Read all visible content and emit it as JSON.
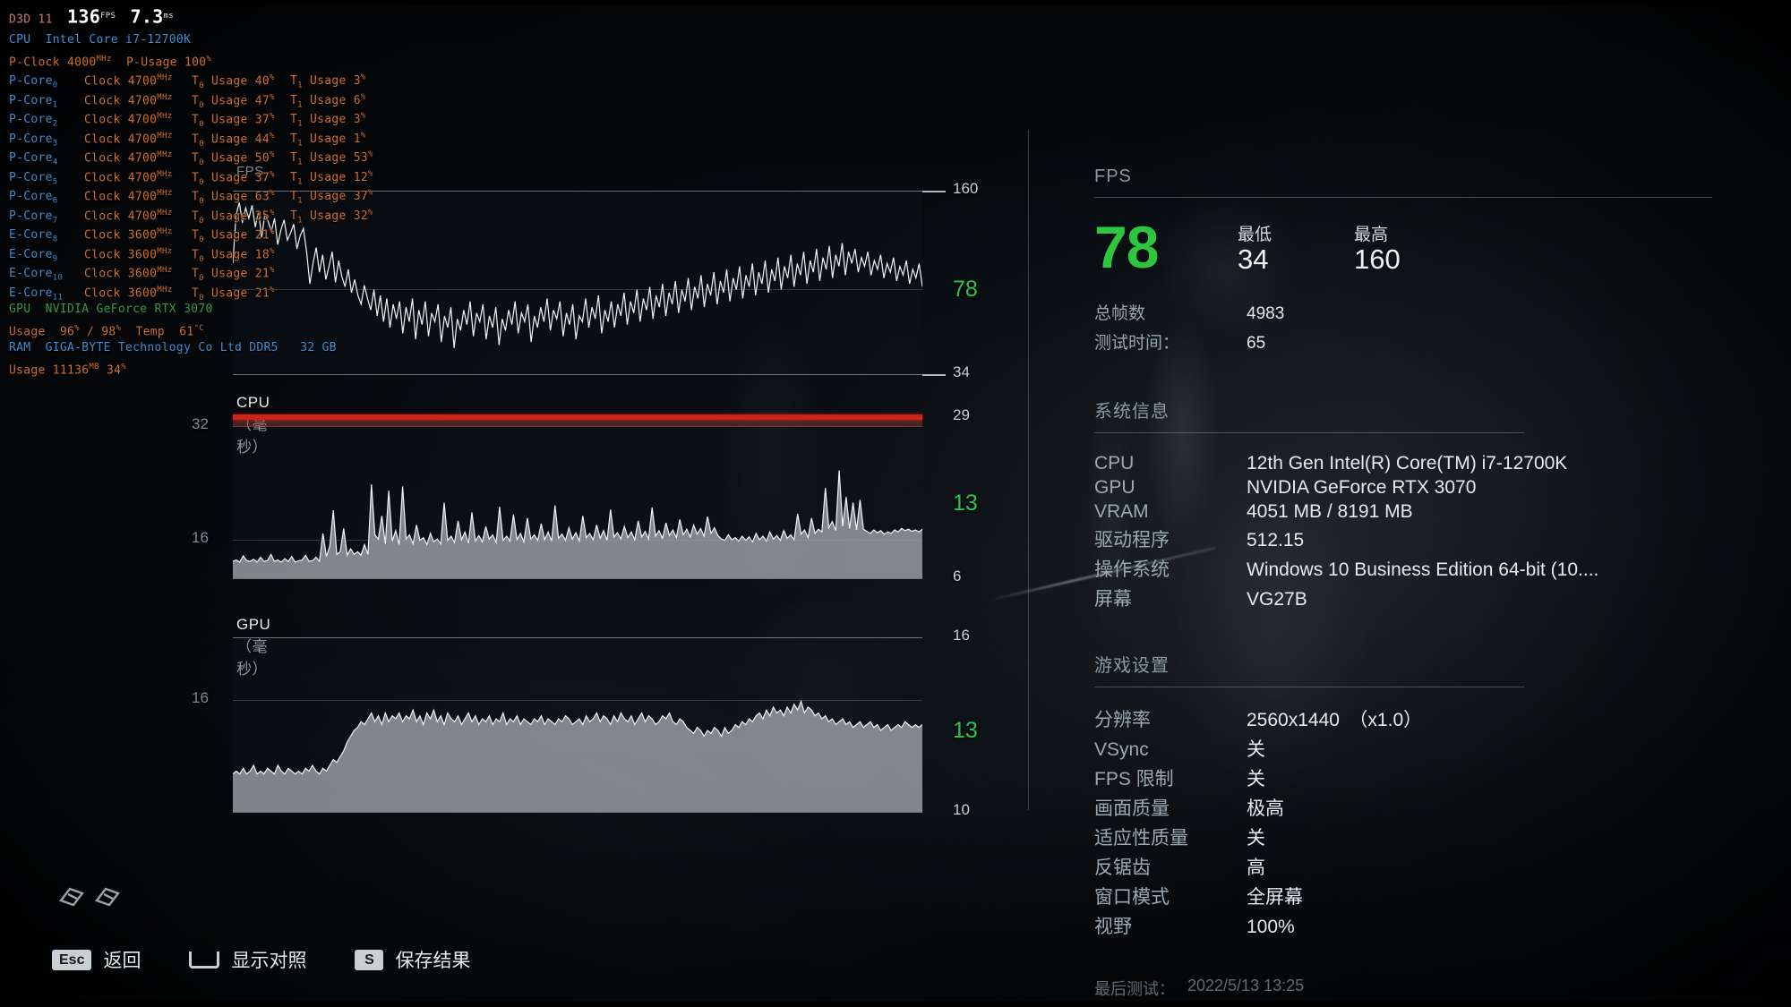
{
  "osd": {
    "api": "D3D 11",
    "fps_value": "136",
    "fps_unit": "FPS",
    "frametime_value": "7.3",
    "frametime_unit": "ms",
    "cpu_label": "CPU",
    "cpu_name": "Intel Core i7-12700K",
    "pclock_label": "P-Clock",
    "pclock_value": "4000",
    "pclock_unit": "MHz",
    "pusage_label": "P-Usage",
    "pusage_value": "100",
    "pusage_unit": "%",
    "cores": [
      {
        "name": "P-Core",
        "idx": "0",
        "clock_label": "Clock",
        "clock": "4700",
        "clock_unit": "MHz",
        "t0_label": "T",
        "t0_idx": "0",
        "t0_usage_label": "Usage",
        "t0": "40",
        "t1_label": "T",
        "t1_idx": "1",
        "t1_usage_label": "Usage",
        "t1": "3",
        "unit": "%"
      },
      {
        "name": "P-Core",
        "idx": "1",
        "clock_label": "Clock",
        "clock": "4700",
        "clock_unit": "MHz",
        "t0_label": "T",
        "t0_idx": "0",
        "t0_usage_label": "Usage",
        "t0": "47",
        "t1_label": "T",
        "t1_idx": "1",
        "t1_usage_label": "Usage",
        "t1": "6",
        "unit": "%"
      },
      {
        "name": "P-Core",
        "idx": "2",
        "clock_label": "Clock",
        "clock": "4700",
        "clock_unit": "MHz",
        "t0_label": "T",
        "t0_idx": "0",
        "t0_usage_label": "Usage",
        "t0": "37",
        "t1_label": "T",
        "t1_idx": "1",
        "t1_usage_label": "Usage",
        "t1": "3",
        "unit": "%"
      },
      {
        "name": "P-Core",
        "idx": "3",
        "clock_label": "Clock",
        "clock": "4700",
        "clock_unit": "MHz",
        "t0_label": "T",
        "t0_idx": "0",
        "t0_usage_label": "Usage",
        "t0": "44",
        "t1_label": "T",
        "t1_idx": "1",
        "t1_usage_label": "Usage",
        "t1": "1",
        "unit": "%"
      },
      {
        "name": "P-Core",
        "idx": "4",
        "clock_label": "Clock",
        "clock": "4700",
        "clock_unit": "MHz",
        "t0_label": "T",
        "t0_idx": "0",
        "t0_usage_label": "Usage",
        "t0": "50",
        "t1_label": "T",
        "t1_idx": "1",
        "t1_usage_label": "Usage",
        "t1": "53",
        "unit": "%"
      },
      {
        "name": "P-Core",
        "idx": "5",
        "clock_label": "Clock",
        "clock": "4700",
        "clock_unit": "MHz",
        "t0_label": "T",
        "t0_idx": "0",
        "t0_usage_label": "Usage",
        "t0": "37",
        "t1_label": "T",
        "t1_idx": "1",
        "t1_usage_label": "Usage",
        "t1": "12",
        "unit": "%"
      },
      {
        "name": "P-Core",
        "idx": "6",
        "clock_label": "Clock",
        "clock": "4700",
        "clock_unit": "MHz",
        "t0_label": "T",
        "t0_idx": "0",
        "t0_usage_label": "Usage",
        "t0": "63",
        "t1_label": "T",
        "t1_idx": "1",
        "t1_usage_label": "Usage",
        "t1": "37",
        "unit": "%"
      },
      {
        "name": "P-Core",
        "idx": "7",
        "clock_label": "Clock",
        "clock": "4700",
        "clock_unit": "MHz",
        "t0_label": "T",
        "t0_idx": "0",
        "t0_usage_label": "Usage",
        "t0": "35",
        "t1_label": "T",
        "t1_idx": "1",
        "t1_usage_label": "Usage",
        "t1": "32",
        "unit": "%"
      },
      {
        "name": "E-Core",
        "idx": "8",
        "clock_label": "Clock",
        "clock": "3600",
        "clock_unit": "MHz",
        "t0_label": "T",
        "t0_idx": "0",
        "t0_usage_label": "Usage",
        "t0": "21",
        "t1_label": "",
        "t1_idx": "",
        "t1_usage_label": "",
        "t1": "",
        "unit": "%"
      },
      {
        "name": "E-Core",
        "idx": "9",
        "clock_label": "Clock",
        "clock": "3600",
        "clock_unit": "MHz",
        "t0_label": "T",
        "t0_idx": "0",
        "t0_usage_label": "Usage",
        "t0": "18",
        "t1_label": "",
        "t1_idx": "",
        "t1_usage_label": "",
        "t1": "",
        "unit": "%"
      },
      {
        "name": "E-Core",
        "idx": "10",
        "clock_label": "Clock",
        "clock": "3600",
        "clock_unit": "MHz",
        "t0_label": "T",
        "t0_idx": "0",
        "t0_usage_label": "Usage",
        "t0": "21",
        "t1_label": "",
        "t1_idx": "",
        "t1_usage_label": "",
        "t1": "",
        "unit": "%"
      },
      {
        "name": "E-Core",
        "idx": "11",
        "clock_label": "Clock",
        "clock": "3600",
        "clock_unit": "MHz",
        "t0_label": "T",
        "t0_idx": "0",
        "t0_usage_label": "Usage",
        "t0": "21",
        "t1_label": "",
        "t1_idx": "",
        "t1_usage_label": "",
        "t1": "",
        "unit": "%"
      }
    ],
    "gpu_label": "GPU",
    "gpu_name": "NVIDIA GeForce RTX 3070",
    "gpu_usage_label": "Usage",
    "gpu_usage": "96",
    "gpu_usage2": "98",
    "gpu_usage_sep": "/",
    "gpu_temp_label": "Temp",
    "gpu_temp": "61",
    "gpu_temp_unit": "°C",
    "pct": "%",
    "ram_label": "RAM",
    "ram_name": "GIGA-BYTE Technology Co Ltd DDR5",
    "ram_size": "32 GB",
    "ram_usage_label": "Usage",
    "ram_usage_mb": "11136",
    "ram_usage_mb_unit": "MB",
    "ram_usage_pct": "34"
  },
  "chart_data": [
    {
      "type": "line",
      "title": "FPS",
      "name": "fps-chart",
      "ylabel": "",
      "ylim": [
        34,
        160
      ],
      "axis_top_label": "160",
      "axis_bottom_label": "34",
      "current_label": "78",
      "current_color": "#2fc24e",
      "grid": true,
      "values": [
        110,
        143,
        152,
        138,
        148,
        141,
        150,
        135,
        146,
        128,
        144,
        139,
        132,
        141,
        123,
        133,
        140,
        126,
        131,
        137,
        120,
        129,
        134,
        118,
        96,
        110,
        121,
        104,
        116,
        99,
        108,
        118,
        97,
        112,
        101,
        94,
        106,
        90,
        99,
        88,
        82,
        95,
        86,
        78,
        92,
        74,
        88,
        70,
        86,
        66,
        82,
        72,
        84,
        62,
        80,
        70,
        86,
        58,
        78,
        68,
        84,
        60,
        76,
        70,
        82,
        56,
        74,
        66,
        80,
        52,
        72,
        64,
        78,
        68,
        84,
        60,
        76,
        70,
        82,
        58,
        74,
        66,
        80,
        54,
        72,
        64,
        78,
        68,
        84,
        62,
        76,
        70,
        82,
        56,
        74,
        66,
        80,
        70,
        86,
        64,
        78,
        72,
        84,
        60,
        76,
        68,
        82,
        58,
        74,
        70,
        86,
        66,
        80,
        72,
        88,
        62,
        78,
        70,
        84,
        66,
        82,
        74,
        90,
        68,
        84,
        76,
        92,
        70,
        86,
        78,
        94,
        72,
        88,
        80,
        96,
        74,
        90,
        82,
        98,
        76,
        92,
        84,
        100,
        78,
        94,
        86,
        102,
        80,
        96,
        88,
        104,
        82,
        98,
        90,
        106,
        84,
        100,
        92,
        108,
        86,
        102,
        94,
        110,
        88,
        104,
        96,
        112,
        90,
        106,
        98,
        114,
        92,
        108,
        100,
        116,
        94,
        110,
        102,
        118,
        96,
        112,
        104,
        120,
        98,
        114,
        106,
        122,
        100,
        116,
        108,
        124,
        102,
        118,
        110,
        120,
        104,
        114,
        108,
        118,
        102,
        112,
        106,
        116,
        100,
        110,
        104,
        114,
        98,
        108,
        102,
        112,
        96,
        106,
        100,
        110,
        94
      ]
    },
    {
      "type": "area",
      "title": "CPU（毫秒）",
      "name": "cpu-chart",
      "ylim": [
        6,
        29
      ],
      "axis_top_label": "29",
      "axis_bottom_label": "6",
      "current_label": "13",
      "current_color": "#2fc24e",
      "left_ticks": [
        "32",
        "16"
      ],
      "threshold_line": 29,
      "grid": true,
      "values": [
        8.4,
        8.6,
        8.3,
        9.2,
        8.5,
        8.4,
        8.7,
        8.3,
        9.0,
        8.4,
        8.5,
        9.4,
        8.4,
        8.6,
        8.3,
        8.8,
        8.4,
        9.1,
        8.3,
        8.5,
        8.6,
        9.3,
        8.4,
        8.5,
        9.0,
        8.4,
        12.4,
        9.1,
        10.6,
        15.7,
        9.4,
        9.8,
        13.1,
        9.3,
        10.2,
        9.4,
        9.8,
        9.3,
        10.8,
        9.4,
        19.4,
        12.2,
        11.6,
        14.9,
        10.9,
        18.5,
        11.3,
        12.8,
        10.8,
        19.1,
        11.6,
        12.2,
        10.9,
        13.6,
        11.4,
        11.8,
        10.8,
        12.4,
        11.2,
        11.6,
        10.9,
        16.8,
        11.4,
        12.0,
        11.1,
        14.2,
        11.5,
        12.6,
        11.0,
        15.4,
        11.3,
        12.1,
        11.2,
        13.4,
        11.6,
        12.2,
        11.1,
        16.2,
        11.4,
        12.0,
        11.3,
        15.1,
        11.5,
        12.4,
        11.2,
        14.6,
        11.6,
        12.2,
        11.4,
        13.8,
        11.5,
        12.6,
        11.3,
        16.4,
        11.7,
        12.3,
        11.4,
        13.2,
        11.6,
        12.5,
        11.3,
        14.9,
        11.8,
        12.4,
        11.5,
        13.6,
        11.7,
        12.8,
        11.4,
        15.8,
        11.9,
        12.5,
        11.6,
        13.4,
        11.8,
        12.6,
        11.5,
        14.2,
        11.9,
        12.7,
        11.6,
        16.1,
        12.0,
        12.8,
        11.7,
        13.9,
        12.1,
        12.9,
        11.8,
        14.4,
        12.2,
        13.0,
        11.9,
        13.6,
        12.3,
        13.1,
        12.0,
        14.8,
        12.4,
        13.2,
        12.1,
        11.6,
        11.4,
        12.2,
        11.5,
        11.8,
        11.3,
        12.0,
        11.4,
        11.9,
        11.2,
        12.4,
        11.5,
        12.0,
        11.3,
        12.6,
        11.6,
        12.1,
        11.4,
        12.8,
        11.7,
        12.2,
        11.5,
        15.2,
        12.3,
        12.9,
        11.8,
        14.6,
        12.4,
        13.0,
        12.6,
        18.9,
        13.2,
        14.1,
        12.8,
        21.4,
        13.4,
        17.6,
        13.1,
        16.8,
        12.9,
        17.2,
        13.0,
        12.7,
        12.4,
        12.9,
        12.5,
        12.8,
        12.3,
        12.6,
        12.4,
        12.9,
        12.6,
        13.1,
        12.8,
        13.0,
        12.7,
        12.9,
        12.6,
        13.0
      ]
    },
    {
      "type": "area",
      "title": "GPU（毫秒）",
      "name": "gpu-chart",
      "ylim": [
        10,
        16
      ],
      "axis_top_label": "16",
      "axis_bottom_label": "10",
      "current_label": "13",
      "current_color": "#2fc24e",
      "left_ticks": [
        "16"
      ],
      "grid": true,
      "values": [
        11.3,
        11.4,
        11.3,
        11.5,
        11.3,
        11.4,
        11.6,
        11.3,
        11.4,
        11.3,
        11.5,
        11.4,
        11.3,
        11.6,
        11.4,
        11.3,
        11.5,
        11.4,
        11.3,
        11.4,
        11.3,
        11.5,
        11.4,
        11.6,
        11.4,
        11.3,
        11.5,
        11.4,
        11.6,
        11.8,
        11.7,
        11.9,
        12.1,
        12.4,
        12.6,
        12.8,
        12.9,
        13.1,
        13.0,
        13.2,
        13.4,
        13.1,
        13.3,
        13.0,
        13.4,
        13.1,
        13.3,
        13.2,
        13.4,
        13.1,
        13.3,
        13.2,
        13.5,
        13.1,
        13.3,
        13.0,
        13.4,
        13.2,
        13.5,
        13.1,
        13.3,
        13.0,
        13.4,
        13.2,
        13.1,
        13.3,
        13.0,
        13.2,
        13.4,
        13.1,
        13.3,
        13.0,
        13.2,
        13.1,
        13.3,
        13.0,
        13.2,
        13.1,
        13.4,
        13.0,
        13.2,
        13.1,
        13.3,
        13.0,
        13.2,
        13.1,
        13.0,
        13.2,
        13.1,
        13.3,
        13.0,
        13.2,
        13.1,
        13.0,
        13.2,
        13.1,
        13.3,
        13.2,
        13.0,
        13.1,
        13.2,
        13.0,
        13.3,
        13.1,
        13.2,
        13.4,
        13.1,
        13.3,
        13.2,
        13.0,
        13.3,
        13.1,
        13.4,
        13.2,
        13.1,
        13.3,
        13.0,
        13.2,
        13.4,
        13.1,
        13.3,
        13.2,
        13.0,
        13.1,
        13.3,
        13.2,
        13.4,
        13.1,
        13.0,
        13.2,
        13.1,
        12.9,
        12.8,
        12.7,
        12.9,
        12.8,
        12.6,
        12.8,
        12.7,
        12.9,
        12.8,
        12.6,
        12.9,
        12.7,
        12.8,
        13.0,
        12.9,
        13.1,
        13.0,
        13.2,
        13.1,
        13.3,
        13.4,
        13.2,
        13.5,
        13.3,
        13.6,
        13.4,
        13.5,
        13.3,
        13.6,
        13.4,
        13.7,
        13.5,
        13.8,
        13.4,
        13.6,
        13.5,
        13.3,
        13.4,
        13.2,
        13.3,
        13.1,
        13.2,
        13.0,
        13.1,
        13.2,
        13.0,
        13.1,
        12.9,
        13.0,
        13.1,
        12.9,
        13.0,
        13.1,
        12.9,
        13.0,
        12.8,
        12.9,
        13.0,
        12.8,
        12.9,
        13.0,
        12.9,
        13.1,
        13.0,
        12.9,
        13.0,
        12.9,
        13.0
      ]
    }
  ],
  "results": {
    "fps_section_title": "FPS",
    "fps_avg": "78",
    "min_label": "最低",
    "min_value": "34",
    "max_label": "最高",
    "max_value": "160",
    "total_frames_label": "总帧数",
    "total_frames_value": "4983",
    "duration_label": "测试时间：",
    "duration_value": "65",
    "sysinfo_title": "系统信息",
    "sysinfo": [
      {
        "label": "CPU",
        "value": "12th Gen Intel(R) Core(TM) i7-12700K"
      },
      {
        "label": "GPU",
        "value": "NVIDIA GeForce RTX 3070"
      },
      {
        "label": "VRAM",
        "value": "4051 MB / 8191 MB"
      },
      {
        "label": "驱动程序",
        "value": "512.15"
      },
      {
        "label": "操作系统",
        "value": "Windows 10 Business Edition 64-bit (10...."
      },
      {
        "label": "屏幕",
        "value": "VG27B"
      }
    ],
    "settings_title": "游戏设置",
    "settings": [
      {
        "label": "分辨率",
        "value": "2560x1440　（x1.0）"
      },
      {
        "label": "VSync",
        "value": "关"
      },
      {
        "label": "FPS 限制",
        "value": "关"
      },
      {
        "label": "画面质量",
        "value": "极高"
      },
      {
        "label": "适应性质量",
        "value": "关"
      },
      {
        "label": "反锯齿",
        "value": "高"
      },
      {
        "label": "窗口模式",
        "value": "全屏幕"
      },
      {
        "label": "视野",
        "value": "100%"
      }
    ],
    "last_test_label": "最后测试：",
    "last_test_value": "2022/5/13 13:25"
  },
  "hints": [
    {
      "key": "Esc",
      "key_type": "text",
      "label": "返回"
    },
    {
      "key": "",
      "key_type": "space",
      "label": "显示对照"
    },
    {
      "key": "S",
      "key_type": "text",
      "label": "保存结果"
    }
  ],
  "colors": {
    "accent_green": "#2fc24e",
    "osd_header": "#3c8fd0",
    "osd_value": "#d2702a",
    "osd_gpu": "#2f9e46",
    "threshold_red": "#cf2218"
  }
}
